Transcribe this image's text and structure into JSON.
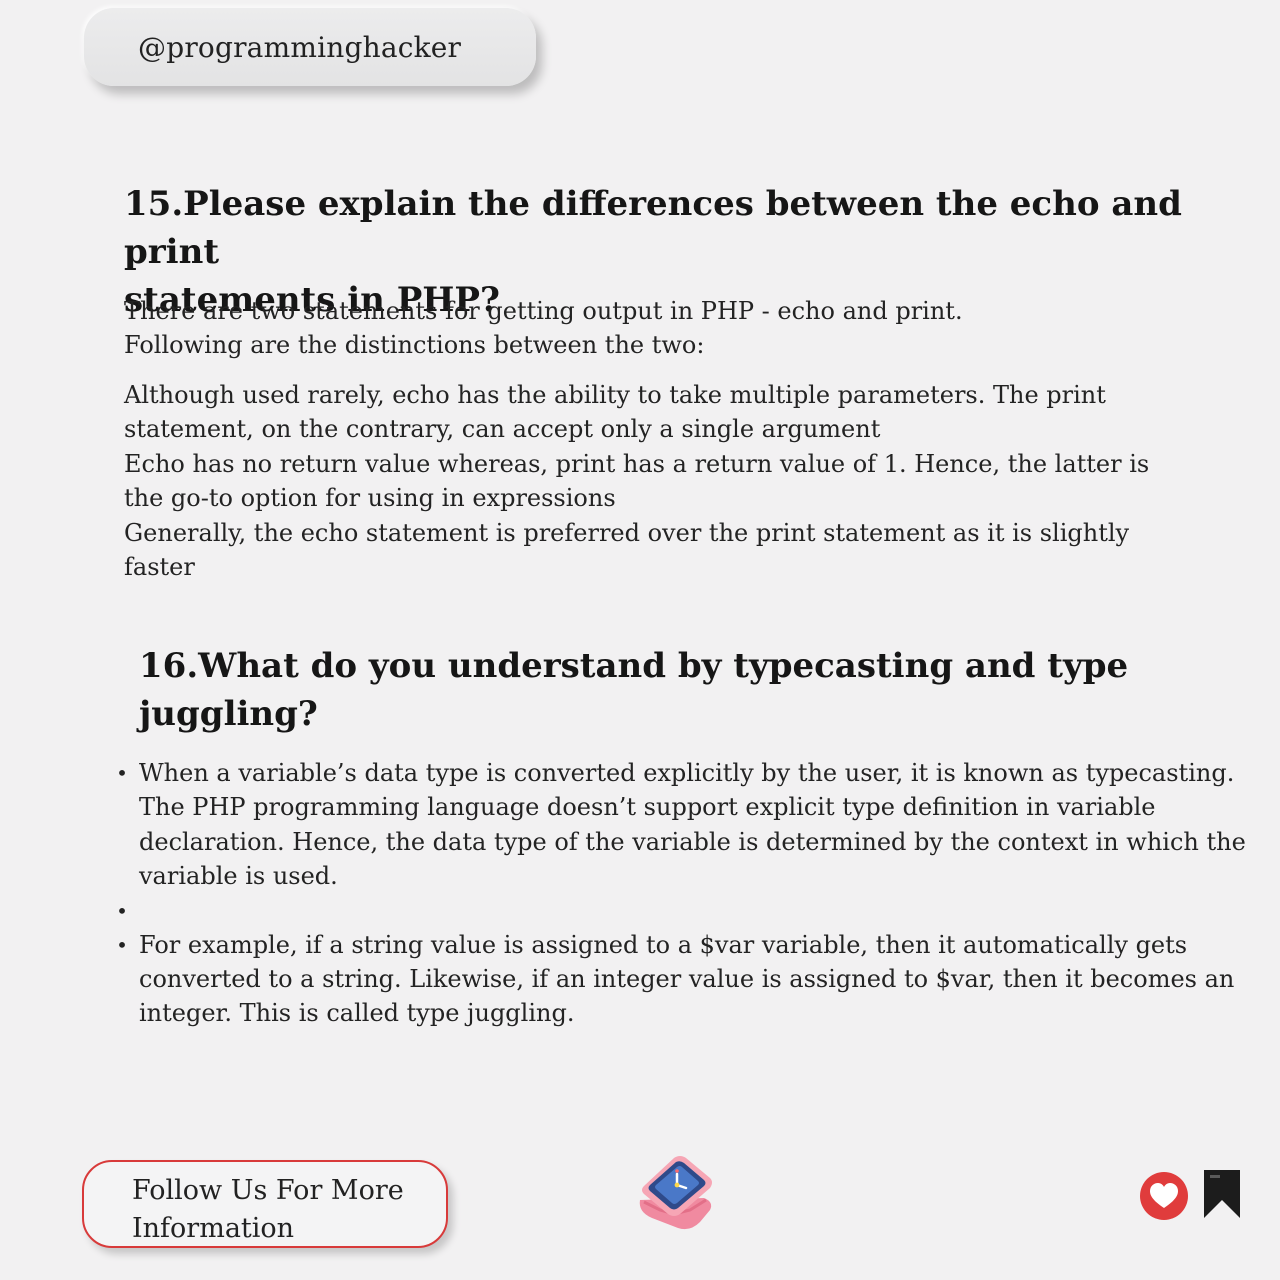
{
  "header": {
    "handle": "@programminghacker"
  },
  "q15": {
    "title_line1": "15.Please explain the differences between the echo and print",
    "title_line2": "statements in PHP?",
    "intro_line1": "There are two statements for getting output in PHP - echo and print.",
    "intro_line2": "Following are the distinctions between the two:",
    "points": [
      "Although used rarely, echo has the ability to take multiple parameters. The print statement, on the contrary, can accept only a single argument",
      "Echo has no return value whereas, print has a return value of 1. Hence, the latter is the go-to option for using in expressions",
      "Generally, the echo statement is preferred over the print statement as it is slightly faster"
    ]
  },
  "q16": {
    "title_line1": "16.What do you understand by typecasting and type",
    "title_line2": "juggling?",
    "bullets": [
      "When a variable’s data type is converted explicitly by the user, it is known as typecasting. The PHP programming language doesn’t support explicit type definition in variable declaration. Hence, the data type of the variable is determined by the context in which the variable is used.",
      "",
      "For example, if a string value is assigned to a $var variable, then it automatically gets converted to a string. Likewise, if an integer value is assigned to $var, then it becomes an integer. This is called type juggling."
    ],
    "bullet_glyph": "•"
  },
  "footer": {
    "follow_line1": "Follow Us For More",
    "follow_line2": "Information",
    "logo_icon": "smartwatch-logo-icon",
    "like_icon": "heart-icon",
    "save_icon": "bookmark-icon",
    "accent_color": "#e03c3c"
  }
}
